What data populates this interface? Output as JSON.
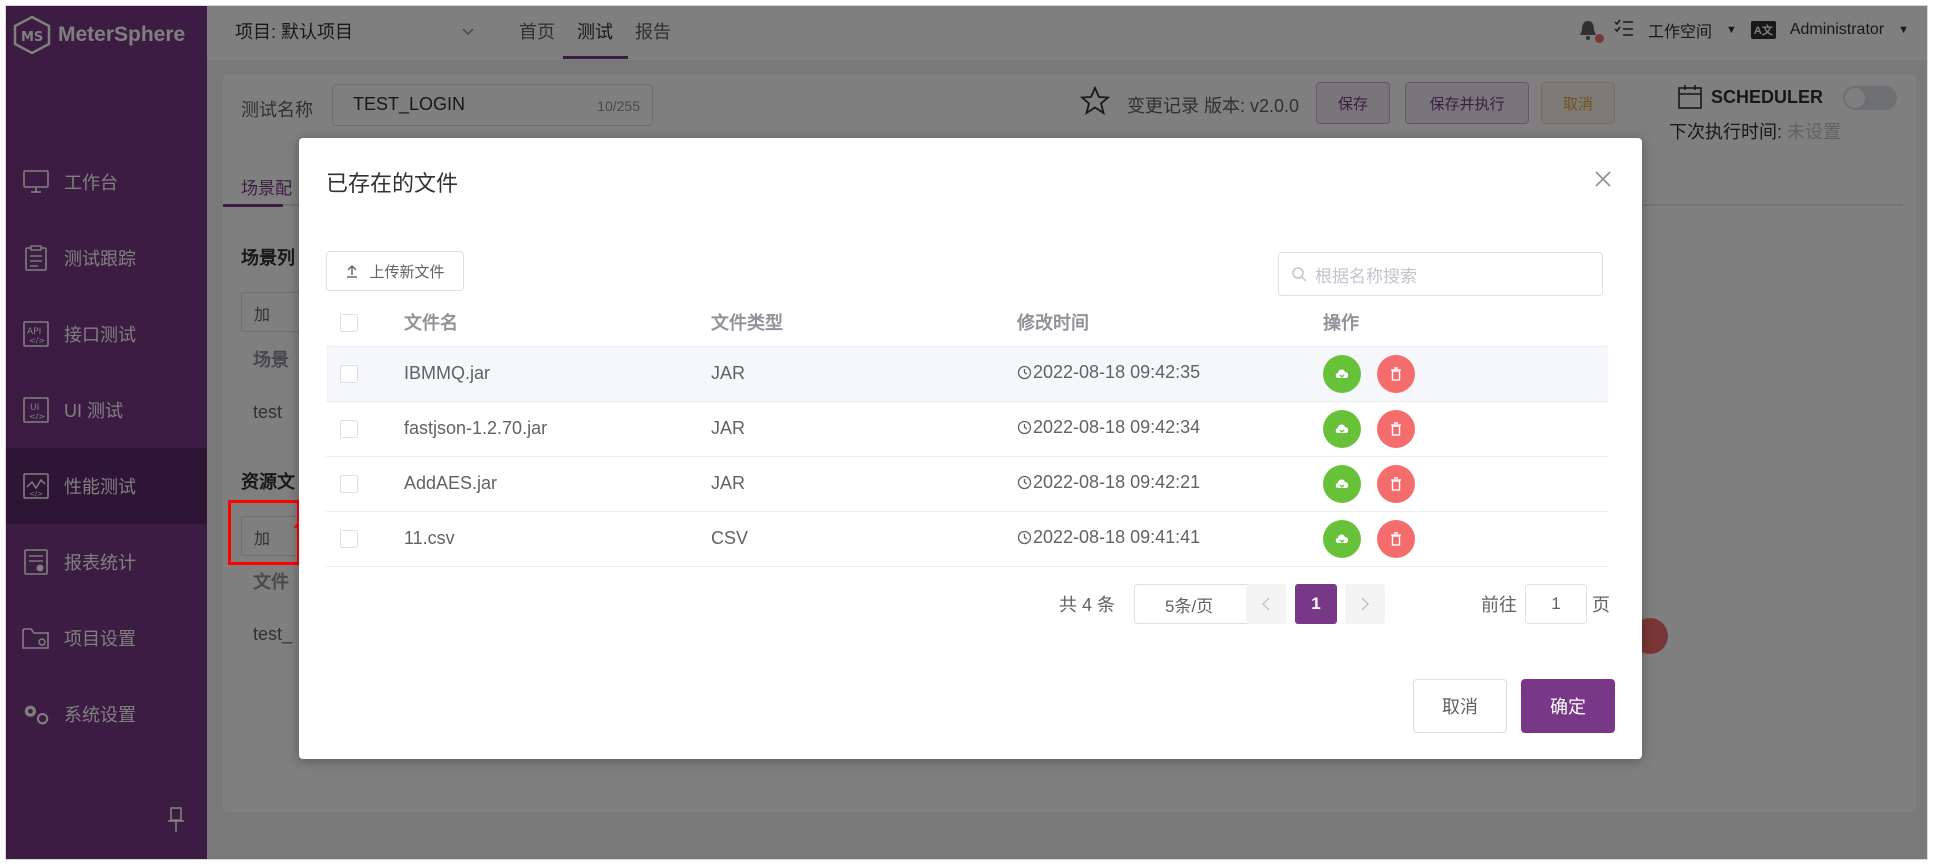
{
  "app": {
    "name": "MeterSphere"
  },
  "header": {
    "project_label": "项目: 默认项目",
    "tabs": [
      {
        "label": "首页"
      },
      {
        "label": "测试"
      },
      {
        "label": "报告"
      }
    ],
    "workspace": "工作空间",
    "user": "Administrator"
  },
  "sidebar": {
    "items": [
      {
        "label": "工作台",
        "icon": "monitor-icon"
      },
      {
        "label": "测试跟踪",
        "icon": "clipboard-icon"
      },
      {
        "label": "接口测试",
        "icon": "api-icon"
      },
      {
        "label": "UI 测试",
        "icon": "ui-icon"
      },
      {
        "label": "性能测试",
        "icon": "chart-icon"
      },
      {
        "label": "报表统计",
        "icon": "report-icon"
      },
      {
        "label": "项目设置",
        "icon": "folder-icon"
      },
      {
        "label": "系统设置",
        "icon": "gears-icon"
      }
    ]
  },
  "page": {
    "name_label": "测试名称",
    "name_value": "TEST_LOGIN",
    "name_count": "10/255",
    "version_text": "变更记录 版本: v2.0.0",
    "save": "保存",
    "save_run": "保存并执行",
    "cancel": "取消",
    "scheduler": "SCHEDULER",
    "next_run_label": "下次执行时间:",
    "next_run_value": "未设置",
    "sub_tab": "场景配",
    "scene_list": "场景列",
    "add": "加",
    "scene_col": "场景",
    "scene_row": "test",
    "resource": "资源文",
    "file_col": "文件",
    "file_row": "test_"
  },
  "dialog": {
    "title": "已存在的文件",
    "upload_label": "上传新文件",
    "search_placeholder": "根据名称搜索",
    "columns": [
      "文件名",
      "文件类型",
      "修改时间",
      "操作"
    ],
    "rows": [
      {
        "name": "IBMMQ.jar",
        "type": "JAR",
        "time": "2022-08-18 09:42:35"
      },
      {
        "name": "fastjson-1.2.70.jar",
        "type": "JAR",
        "time": "2022-08-18 09:42:34"
      },
      {
        "name": "AddAES.jar",
        "type": "JAR",
        "time": "2022-08-18 09:42:21"
      },
      {
        "name": "11.csv",
        "type": "CSV",
        "time": "2022-08-18 09:41:41"
      }
    ],
    "pager": {
      "total": "共 4 条",
      "page_size": "5条/页",
      "current": "1",
      "goto": "前往",
      "goto_value": "1",
      "page_suffix": "页"
    },
    "cancel": "取消",
    "confirm": "确定"
  },
  "colors": {
    "brand": "#783887",
    "green": "#67c23a",
    "red": "#f56c6c"
  }
}
